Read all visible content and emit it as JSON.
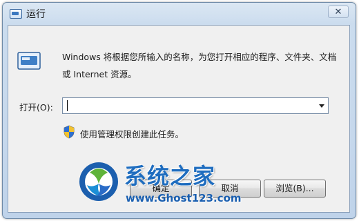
{
  "window": {
    "title": "运行",
    "close_label": "✕"
  },
  "dialog": {
    "description": "Windows 将根据您所输入的名称，为您打开相应的程序、文件夹、文档或 Internet 资源。",
    "open_label": "打开(O):",
    "open_value": "",
    "admin_note": "使用管理权限创建此任务。"
  },
  "buttons": {
    "ok_label": "确定",
    "cancel_label": "取消",
    "browse_label": "浏览(B)..."
  },
  "watermark": {
    "title": "系统之家",
    "url": "www.Ghost123.com"
  },
  "colors": {
    "accent": "#1f6dbf",
    "titlebar": "#cbdcee",
    "client": "#f0f0f0"
  },
  "icons": {
    "app": "run-icon",
    "shield": "uac-shield-icon",
    "dropdown": "chevron-down-icon"
  }
}
